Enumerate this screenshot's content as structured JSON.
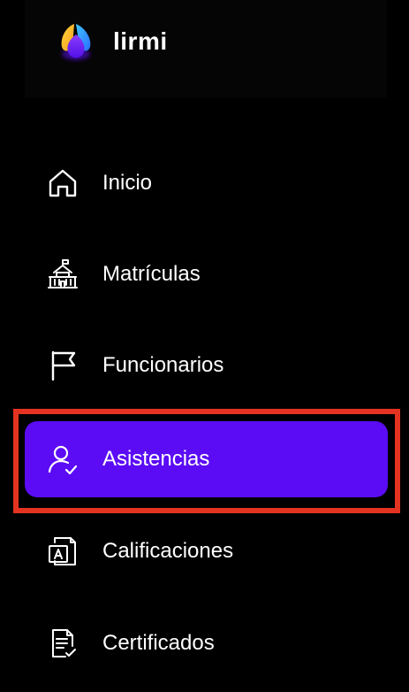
{
  "app": {
    "name": "lirmi"
  },
  "colors": {
    "background": "#000000",
    "active_item": "#5b0cf5",
    "highlight_border": "#e53322",
    "text": "#ffffff"
  },
  "sidebar": {
    "items": [
      {
        "label": "Inicio",
        "icon": "home-icon",
        "active": false
      },
      {
        "label": "Matrículas",
        "icon": "school-building-icon",
        "active": false
      },
      {
        "label": "Funcionarios",
        "icon": "flag-icon",
        "active": false
      },
      {
        "label": "Asistencias",
        "icon": "user-check-icon",
        "active": true
      },
      {
        "label": "Calificaciones",
        "icon": "grade-document-icon",
        "active": false
      },
      {
        "label": "Certificados",
        "icon": "certificate-document-icon",
        "active": false
      }
    ]
  }
}
